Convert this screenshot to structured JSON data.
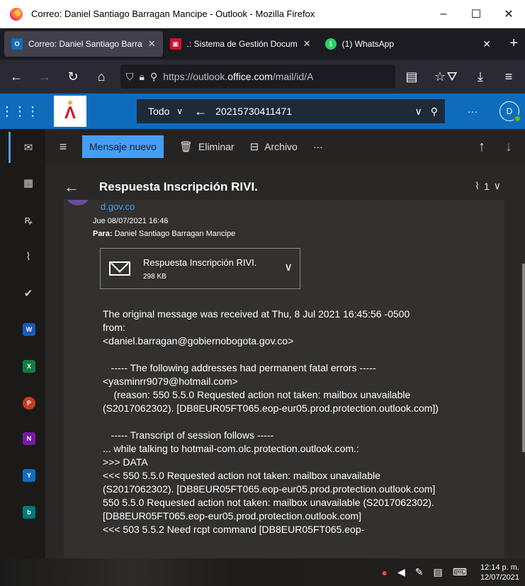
{
  "window": {
    "title": "Correo: Daniel Santiago Barragan Mancipe - Outlook - Mozilla Firefox",
    "minimize": "–",
    "maximize": "☐",
    "close": "✕"
  },
  "tabs": [
    {
      "label": "Correo: Daniel Santiago Barra",
      "icon": "outlook-icon",
      "color": "#0f6cbd"
    },
    {
      "label": ".: Sistema de Gestión Docum",
      "icon": "doc-system-icon",
      "color": "#d4122b"
    },
    {
      "label": "(1) WhatsApp",
      "icon": "whatsapp-icon",
      "color": "#25d366"
    }
  ],
  "browser": {
    "url_prefix": "https://outlook.",
    "url_domain": "office.com",
    "url_rest": "/mail/id/A"
  },
  "outlook_header": {
    "search_scope": "Todo",
    "search_query": "20215730411471",
    "more": "···",
    "avatar_initial": "D"
  },
  "toolbar": {
    "new_message": "Mensaje nuevo",
    "delete": "Eliminar",
    "archive": "Archivo",
    "more": "···"
  },
  "message": {
    "subject": "Respuesta Inscripción RIVI.",
    "attachment_count": "1",
    "sender_partial": "d.gov.co",
    "date": "Jue 08/07/2021 16:46",
    "to_label": "Para:",
    "to": "Daniel Santiago Barragan Mancipe",
    "attachment": {
      "name": "Respuesta Inscripción RIVI.",
      "size": "298 KB"
    },
    "body": "The original message was received at Thu, 8 Jul 2021 16:45:56 -0500\nfrom:\n<daniel.barragan@gobiernobogota.gov.co>\n\n   ----- The following addresses had permanent fatal errors -----\n<yasminrr9079@hotmail.com>\n    (reason: 550 5.5.0 Requested action not taken: mailbox unavailable\n(S2017062302). [DB8EUR05FT065.eop-eur05.prod.protection.outlook.com])\n\n   ----- Transcript of session follows -----\n... while talking to hotmail-com.olc.protection.outlook.com.:\n>>> DATA\n<<< 550 5.5.0 Requested action not taken: mailbox unavailable\n(S2017062302). [DB8EUR05FT065.eop-eur05.prod.protection.outlook.com]\n550 5.5.0 Requested action not taken: mailbox unavailable (S2017062302).\n[DB8EUR05FT065.eop-eur05.prod.protection.outlook.com]\n<<< 503 5.5.2 Need rcpt command [DB8EUR05FT065.eop-"
  },
  "taskbar": {
    "time": "12:14 p. m.",
    "date": "12/07/2021"
  },
  "colors": {
    "outlook_blue": "#0f6cbd",
    "new_message_button": "#479ef5",
    "presence_available": "#6bb700"
  }
}
